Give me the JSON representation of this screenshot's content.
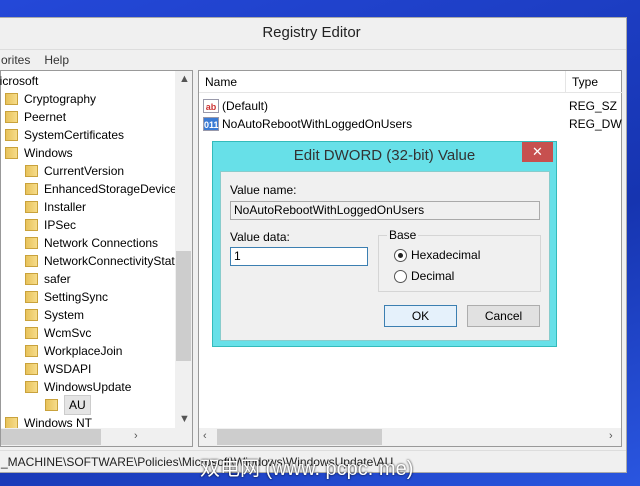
{
  "window": {
    "title": "Registry Editor",
    "menu": [
      "orites",
      "Help"
    ]
  },
  "tree": {
    "items": [
      {
        "label": "licrosoft",
        "level": 0
      },
      {
        "label": "Cryptography",
        "level": 1
      },
      {
        "label": "Peernet",
        "level": 1
      },
      {
        "label": "SystemCertificates",
        "level": 1
      },
      {
        "label": "Windows",
        "level": 1
      },
      {
        "label": "CurrentVersion",
        "level": 2
      },
      {
        "label": "EnhancedStorageDevices",
        "level": 2
      },
      {
        "label": "Installer",
        "level": 2
      },
      {
        "label": "IPSec",
        "level": 2
      },
      {
        "label": "Network Connections",
        "level": 2
      },
      {
        "label": "NetworkConnectivityStatusI",
        "level": 2
      },
      {
        "label": "safer",
        "level": 2
      },
      {
        "label": "SettingSync",
        "level": 2
      },
      {
        "label": "System",
        "level": 2
      },
      {
        "label": "WcmSvc",
        "level": 2
      },
      {
        "label": "WorkplaceJoin",
        "level": 2
      },
      {
        "label": "WSDAPI",
        "level": 2
      },
      {
        "label": "WindowsUpdate",
        "level": 2
      },
      {
        "label": "AU",
        "level": 3,
        "selected": true
      },
      {
        "label": "Windows NT",
        "level": 1
      }
    ]
  },
  "list": {
    "columns": [
      "Name",
      "Type"
    ],
    "rows": [
      {
        "name": "(Default)",
        "type": "REG_SZ",
        "icon": "ab"
      },
      {
        "name": "NoAutoRebootWithLoggedOnUsers",
        "type": "REG_DW",
        "icon": "011"
      }
    ]
  },
  "status": {
    "path": "_MACHINE\\SOFTWARE\\Policies\\Microsoft\\Windows\\WindowsUpdate\\AU"
  },
  "dialog": {
    "title": "Edit DWORD (32-bit) Value",
    "close": "✕",
    "value_name_label": "Value name:",
    "value_name": "NoAutoRebootWithLoggedOnUsers",
    "value_data_label": "Value data:",
    "value_data": "1",
    "base_label": "Base",
    "base_options": [
      "Hexadecimal",
      "Decimal"
    ],
    "base_selected": "Hexadecimal",
    "ok": "OK",
    "cancel": "Cancel"
  },
  "watermark": "双电网 (www. pcpc. me)"
}
